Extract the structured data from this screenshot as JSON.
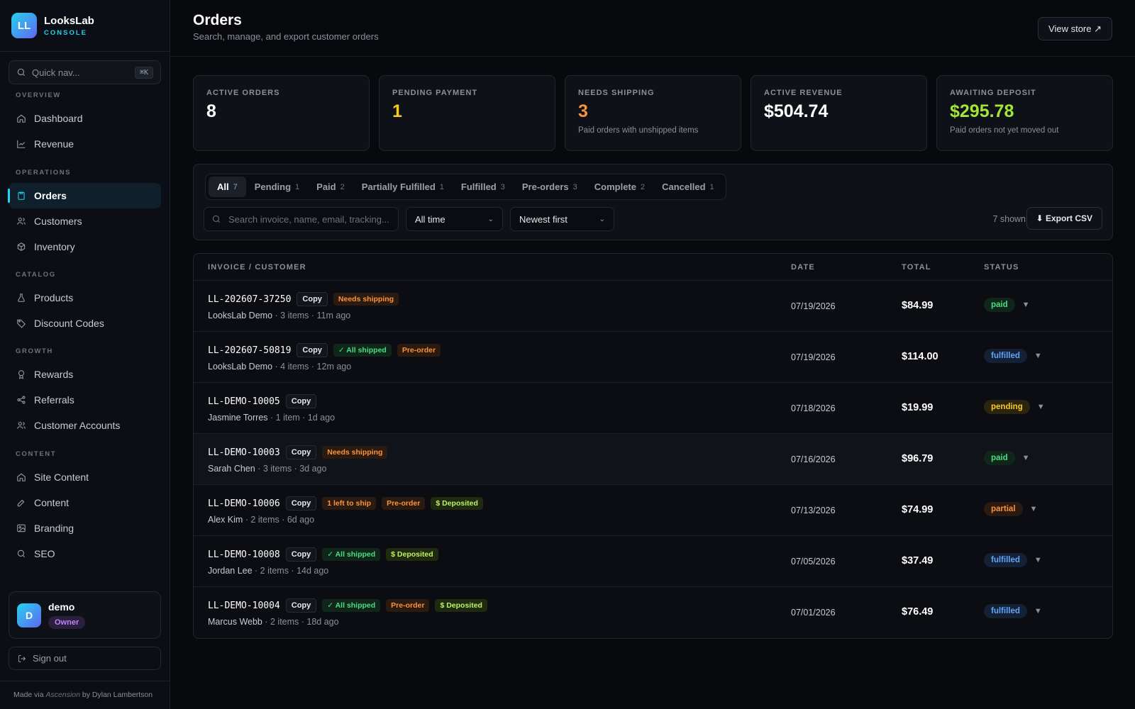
{
  "brand": {
    "initials": "LL",
    "name": "LooksLab",
    "sub": "CONSOLE"
  },
  "quicknav": {
    "placeholder": "Quick nav...",
    "shortcut": "⌘K"
  },
  "sidebar": {
    "sections": [
      {
        "title": "OVERVIEW",
        "items": [
          {
            "label": "Dashboard",
            "icon": "home-icon"
          },
          {
            "label": "Revenue",
            "icon": "chart-line-icon"
          }
        ]
      },
      {
        "title": "OPERATIONS",
        "items": [
          {
            "label": "Orders",
            "icon": "clipboard-icon",
            "active": true
          },
          {
            "label": "Customers",
            "icon": "users-icon"
          },
          {
            "label": "Inventory",
            "icon": "box-icon"
          }
        ]
      },
      {
        "title": "CATALOG",
        "items": [
          {
            "label": "Products",
            "icon": "flask-icon"
          },
          {
            "label": "Discount Codes",
            "icon": "tag-icon"
          }
        ]
      },
      {
        "title": "GROWTH",
        "items": [
          {
            "label": "Rewards",
            "icon": "award-icon"
          },
          {
            "label": "Referrals",
            "icon": "share-icon"
          },
          {
            "label": "Customer Accounts",
            "icon": "users-icon"
          }
        ]
      },
      {
        "title": "CONTENT",
        "items": [
          {
            "label": "Site Content",
            "icon": "home-icon"
          },
          {
            "label": "Content",
            "icon": "edit-icon"
          },
          {
            "label": "Branding",
            "icon": "image-icon"
          },
          {
            "label": "SEO",
            "icon": "search-icon"
          }
        ]
      }
    ]
  },
  "user": {
    "initial": "D",
    "name": "demo",
    "role": "Owner"
  },
  "signout": "Sign out",
  "footer": {
    "prefix": "Made via",
    "product": "Ascension",
    "suffix": "by Dylan Lambertson"
  },
  "page": {
    "title": "Orders",
    "subtitle": "Search, manage, and export customer orders",
    "view_store": "View store ↗"
  },
  "stats": [
    {
      "label": "ACTIVE ORDERS",
      "value": "8",
      "note": "",
      "color": "#ffffff"
    },
    {
      "label": "PENDING PAYMENT",
      "value": "1",
      "note": "",
      "color": "#facc15"
    },
    {
      "label": "NEEDS SHIPPING",
      "value": "3",
      "note": "Paid orders with unshipped items",
      "color": "#fb923c"
    },
    {
      "label": "ACTIVE REVENUE",
      "value": "$504.74",
      "note": "",
      "color": "#ffffff"
    },
    {
      "label": "AWAITING DEPOSIT",
      "value": "$295.78",
      "note": "Paid orders not yet moved out",
      "color": "#a3e635"
    }
  ],
  "tabs": [
    {
      "label": "All",
      "count": "7",
      "active": true
    },
    {
      "label": "Pending",
      "count": "1"
    },
    {
      "label": "Paid",
      "count": "2"
    },
    {
      "label": "Partially Fulfilled",
      "count": "1"
    },
    {
      "label": "Fulfilled",
      "count": "3"
    },
    {
      "label": "Pre-orders",
      "count": "3"
    },
    {
      "label": "Complete",
      "count": "2"
    },
    {
      "label": "Cancelled",
      "count": "1"
    }
  ],
  "filters": {
    "search_placeholder": "Search invoice, name, email, tracking...",
    "time": "All time",
    "sort": "Newest first",
    "shown": "7 shown",
    "export": "⬇ Export CSV"
  },
  "table": {
    "headers": {
      "invoice": "INVOICE / CUSTOMER",
      "date": "DATE",
      "total": "TOTAL",
      "status": "STATUS"
    },
    "rows": [
      {
        "invoice": "LL-202607-37250",
        "badges": [
          {
            "text": "Needs shipping",
            "kind": "ship"
          }
        ],
        "customer": "LooksLab Demo",
        "meta": " · 3 items · 11m ago",
        "date": "07/19/2026",
        "total": "$84.99",
        "status": "paid"
      },
      {
        "invoice": "LL-202607-50819",
        "badges": [
          {
            "text": "✓ All shipped",
            "kind": "allship"
          },
          {
            "text": "Pre-order",
            "kind": "pre"
          }
        ],
        "customer": "LooksLab Demo",
        "meta": " · 4 items · 12m ago",
        "date": "07/19/2026",
        "total": "$114.00",
        "status": "fulfilled"
      },
      {
        "invoice": "LL-DEMO-10005",
        "badges": [],
        "customer": "Jasmine Torres",
        "meta": " · 1 item · 1d ago",
        "date": "07/18/2026",
        "total": "$19.99",
        "status": "pending"
      },
      {
        "invoice": "LL-DEMO-10003",
        "badges": [
          {
            "text": "Needs shipping",
            "kind": "ship"
          }
        ],
        "customer": "Sarah Chen",
        "meta": " · 3 items · 3d ago",
        "date": "07/16/2026",
        "total": "$96.79",
        "status": "paid",
        "highlight": true
      },
      {
        "invoice": "LL-DEMO-10006",
        "badges": [
          {
            "text": "1 left to ship",
            "kind": "left"
          },
          {
            "text": "Pre-order",
            "kind": "pre"
          },
          {
            "text": "$ Deposited",
            "kind": "dep"
          }
        ],
        "customer": "Alex Kim",
        "meta": " · 2 items · 6d ago",
        "date": "07/13/2026",
        "total": "$74.99",
        "status": "partial"
      },
      {
        "invoice": "LL-DEMO-10008",
        "badges": [
          {
            "text": "✓ All shipped",
            "kind": "allship"
          },
          {
            "text": "$ Deposited",
            "kind": "dep"
          }
        ],
        "customer": "Jordan Lee",
        "meta": " · 2 items · 14d ago",
        "date": "07/05/2026",
        "total": "$37.49",
        "status": "fulfilled"
      },
      {
        "invoice": "LL-DEMO-10004",
        "badges": [
          {
            "text": "✓ All shipped",
            "kind": "allship"
          },
          {
            "text": "Pre-order",
            "kind": "pre"
          },
          {
            "text": "$ Deposited",
            "kind": "dep"
          }
        ],
        "customer": "Marcus Webb",
        "meta": " · 2 items · 18d ago",
        "date": "07/01/2026",
        "total": "$76.49",
        "status": "fulfilled"
      }
    ],
    "copy_label": "Copy",
    "caret": "▼"
  }
}
